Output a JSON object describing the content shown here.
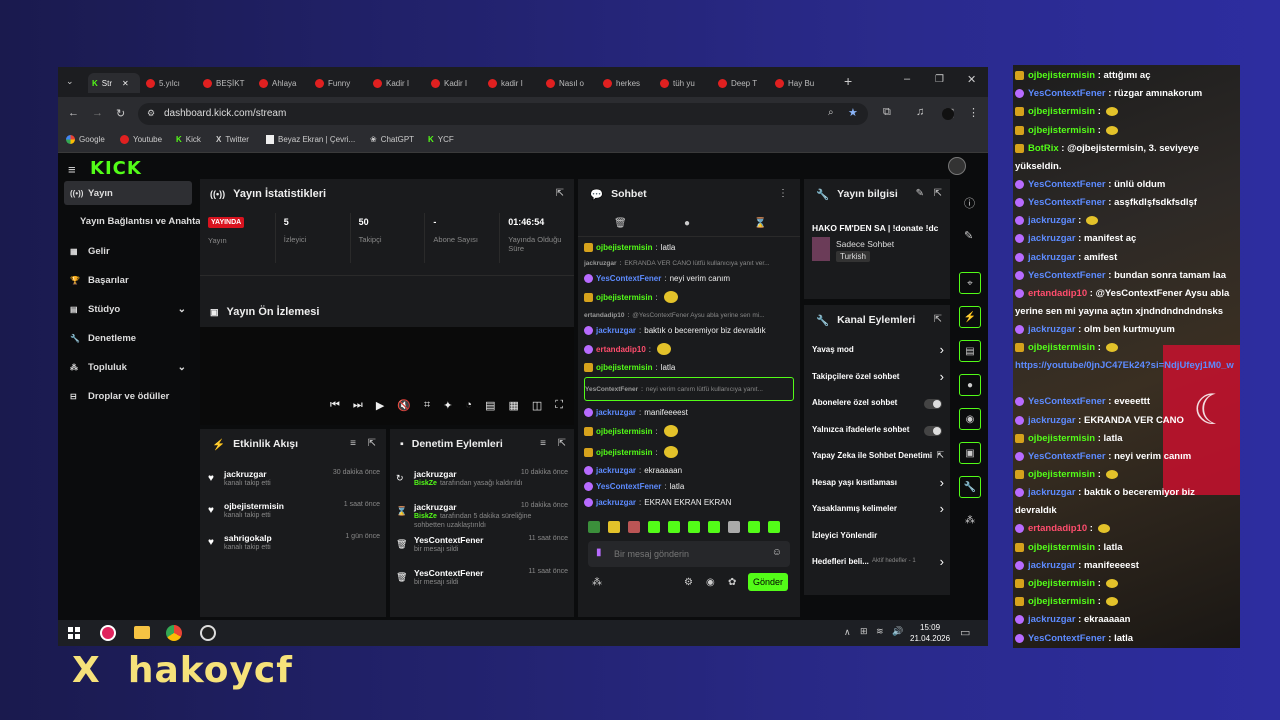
{
  "browser": {
    "tabs": [
      "Str",
      "5.yılcı",
      "BEŞİKT",
      "Ahlaya",
      "Funny",
      "Kadir I",
      "Kadir I",
      "kadir I",
      "Nasıl o",
      "herkes",
      "tüh yu",
      "Deep T",
      "Hay Bu"
    ],
    "url": "dashboard.kick.com/stream",
    "bookmarks": [
      "Google",
      "Youtube",
      "Kick",
      "Twitter",
      "Beyaz Ekran | Çevri...",
      "ChatGPT",
      "YCF"
    ]
  },
  "kick": {
    "logo": "KICK",
    "sidebar": [
      {
        "label": "Yayın",
        "icon": "broadcast-icon"
      },
      {
        "label": "Yayın Bağlantısı ve Anahtarı",
        "icon": ""
      },
      {
        "label": "Gelir",
        "icon": "revenue-icon"
      },
      {
        "label": "Başarılar",
        "icon": "trophy-icon"
      },
      {
        "label": "Stüdyo",
        "icon": "studio-icon"
      },
      {
        "label": "Denetleme",
        "icon": "moderation-icon"
      },
      {
        "label": "Topluluk",
        "icon": "community-icon"
      },
      {
        "label": "Droplar ve ödüller",
        "icon": "gift-icon"
      }
    ],
    "stats": {
      "title": "Yayın İstatistikleri",
      "live_badge": "YAYINDA",
      "items": [
        {
          "value": "",
          "label": "Yayın"
        },
        {
          "value": "5",
          "label": "İzleyici"
        },
        {
          "value": "50",
          "label": "Takipçi"
        },
        {
          "value": "-",
          "label": "Abone Sayısı"
        },
        {
          "value": "01:46:54",
          "label": "Yayında Olduğu Süre"
        }
      ]
    },
    "preview": {
      "title": "Yayın Ön İzlemesi"
    },
    "activity": {
      "title": "Etkinlik Akışı",
      "items": [
        {
          "user": "jackruzgar",
          "text": "kanalı takip etti",
          "time": "30 dakika önce"
        },
        {
          "user": "ojbejistermisin",
          "text": "kanalı takip etti",
          "time": "1 saat önce"
        },
        {
          "user": "sahrigokalp",
          "text": "kanalı takip etti",
          "time": "1 gün önce"
        }
      ]
    },
    "moderation": {
      "title": "Denetim Eylemleri",
      "items": [
        {
          "user": "jackruzgar",
          "by": "BiskZe",
          "text": "tarafından yasağı kaldırıldı",
          "time": "10 dakika önce"
        },
        {
          "user": "jackruzgar",
          "by": "BiskZe",
          "text": "tarafından 5 dakika süreliğine sohbetten uzaklaştırıldı",
          "time": "10 dakika önce"
        },
        {
          "user": "YesContextFener",
          "by": "",
          "text": "bir mesajı sildi",
          "time": "11 saat önce"
        },
        {
          "user": "YesContextFener",
          "by": "",
          "text": "bir mesajı sildi",
          "time": "11 saat önce"
        }
      ]
    },
    "chat": {
      "title": "Sohbet",
      "placeholder": "Bir mesaj gönderin",
      "send": "Gönder",
      "messages": [
        {
          "user": "ojbejistermisin",
          "text": "latla",
          "color": "#53fc18"
        },
        {
          "user": "jackruzgar",
          "text": "EKRANDA VER CANO lütfü kullanıcıya yanıt ver...",
          "color": "#999",
          "reply": true
        },
        {
          "user": "YesContextFener",
          "text": "neyi verim canım",
          "color": "#5d8bff"
        },
        {
          "user": "ojbejistermisin",
          "text": "",
          "color": "#53fc18"
        },
        {
          "user": "ertandadip10",
          "text": "@YesContextFener Aysu abla yerine sen mi...",
          "color": "#999",
          "reply": true
        },
        {
          "user": "jackruzgar",
          "text": "baktık o beceremiyor biz devraldık",
          "color": "#5d8bff"
        },
        {
          "user": "ertandadip10",
          "text": "",
          "color": "#ff4d6d"
        },
        {
          "user": "ojbejistermisin",
          "text": "latla",
          "color": "#53fc18"
        },
        {
          "user": "YesContextFener",
          "text": "neyi verim canım lütfü kullanıcıya yanıt...",
          "color": "#999",
          "reply": true
        },
        {
          "user": "jackruzgar",
          "text": "manifeeeest",
          "color": "#5d8bff"
        },
        {
          "user": "ojbejistermisin",
          "text": "",
          "color": "#53fc18"
        },
        {
          "user": "ojbejistermisin",
          "text": "",
          "color": "#53fc18"
        },
        {
          "user": "jackruzgar",
          "text": "ekraaaaan",
          "color": "#5d8bff"
        },
        {
          "user": "YesContextFener",
          "text": "latla",
          "color": "#5d8bff"
        },
        {
          "user": "jackruzgar",
          "text": "EKRAN EKRAN EKRAN",
          "color": "#5d8bff"
        },
        {
          "user": "jackruzgar",
          "text": "",
          "color": "#5d8bff"
        }
      ]
    },
    "stream_info": {
      "title": "Yayın bilgisi",
      "stream_title": "HAKO FM'DEN SA | !donate !dc",
      "chat_mode": "Sadece Sohbet",
      "language": "Turkish"
    },
    "channel_actions": {
      "title": "Kanal Eylemleri",
      "items": [
        {
          "label": "Yavaş mod",
          "control": "arrow"
        },
        {
          "label": "Takipçilere özel sohbet",
          "control": "arrow"
        },
        {
          "label": "Abonelere özel sohbet",
          "control": "toggle"
        },
        {
          "label": "Yalnızca ifadelerle sohbet",
          "control": "toggle"
        },
        {
          "label": "Yapay Zeka ile Sohbet Denetimi",
          "control": "ext"
        },
        {
          "label": "Hesap yaşı kısıtlaması",
          "control": "arrow"
        },
        {
          "label": "Yasaklanmış kelimeler",
          "control": "arrow"
        },
        {
          "label": "İzleyici Yönlendir",
          "control": ""
        },
        {
          "label": "Hedefleri beli...",
          "control": "arrow",
          "extra": "Aktif hedefler - 1"
        }
      ]
    }
  },
  "taskbar": {
    "time": "15:09",
    "date": "21.04.2026"
  },
  "overlay_chat": [
    {
      "user": "ojbejistermisin",
      "text": "attığımı aç",
      "color": "#53fc18"
    },
    {
      "user": "YesContextFener",
      "text": "rüzgar amınakorum",
      "color": "#5d8bff"
    },
    {
      "user": "ojbejistermisin",
      "text": "",
      "color": "#53fc18"
    },
    {
      "user": "ojbejistermisin",
      "text": "",
      "color": "#53fc18"
    },
    {
      "user": "BotRix",
      "text": "@ojbejistermisin, 3. seviyeye yükseldin.",
      "color": "#53fc18"
    },
    {
      "user": "YesContextFener",
      "text": "ünlü oldum",
      "color": "#5d8bff"
    },
    {
      "user": "YesContextFener",
      "text": "asşfkdlşfsdkfsdlşf",
      "color": "#5d8bff"
    },
    {
      "user": "jackruzgar",
      "text": "",
      "color": "#5d8bff"
    },
    {
      "user": "jackruzgar",
      "text": "manifest aç",
      "color": "#5d8bff"
    },
    {
      "user": "jackruzgar",
      "text": "amifest",
      "color": "#5d8bff"
    },
    {
      "user": "YesContextFener",
      "text": "bundan sonra tamam laa",
      "color": "#5d8bff"
    },
    {
      "user": "ertandadip10",
      "text": "@YesContextFener Aysu abla yerine sen mi yayına açtın xjndndndndndnsks",
      "color": "#ff4d6d"
    },
    {
      "user": "jackruzgar",
      "text": "olm ben kurtmuyum",
      "color": "#5d8bff"
    },
    {
      "user": "ojbejistermisin",
      "text": "",
      "color": "#53fc18"
    },
    {
      "user": "",
      "text": "https://youtube/0jnJC47Ek24?si=NdjUfeyj1M0_w",
      "color": "#5d8bff"
    },
    {
      "user": "YesContextFener",
      "text": "eveeettt",
      "color": "#5d8bff"
    },
    {
      "user": "jackruzgar",
      "text": "EKRANDA VER CANO",
      "color": "#5d8bff"
    },
    {
      "user": "ojbejistermisin",
      "text": "latla",
      "color": "#53fc18"
    },
    {
      "user": "YesContextFener",
      "text": "neyi verim canım",
      "color": "#5d8bff"
    },
    {
      "user": "ojbejistermisin",
      "text": "",
      "color": "#53fc18"
    },
    {
      "user": "jackruzgar",
      "text": "baktık o beceremiyor biz devraldık",
      "color": "#5d8bff"
    },
    {
      "user": "ertandadip10",
      "text": "",
      "color": "#ff4d6d"
    },
    {
      "user": "ojbejistermisin",
      "text": "latla",
      "color": "#53fc18"
    },
    {
      "user": "jackruzgar",
      "text": "manifeeeest",
      "color": "#5d8bff"
    },
    {
      "user": "ojbejistermisin",
      "text": "",
      "color": "#53fc18"
    },
    {
      "user": "ojbejistermisin",
      "text": "",
      "color": "#53fc18"
    },
    {
      "user": "jackruzgar",
      "text": "ekraaaaan",
      "color": "#5d8bff"
    },
    {
      "user": "YesContextFener",
      "text": "latla",
      "color": "#5d8bff"
    },
    {
      "user": "jackruzgar",
      "text": "EKRAN EKRAN EKRAN",
      "color": "#5d8bff"
    },
    {
      "user": "jackruzgar",
      "text": "",
      "color": "#5d8bff"
    }
  ],
  "watermark": "X  hakoycf",
  "colors": {
    "kick_green": "#53fc18",
    "bg": "#0b0c0d",
    "panel": "#1a1b1d",
    "watermark": "#f6e27a"
  }
}
